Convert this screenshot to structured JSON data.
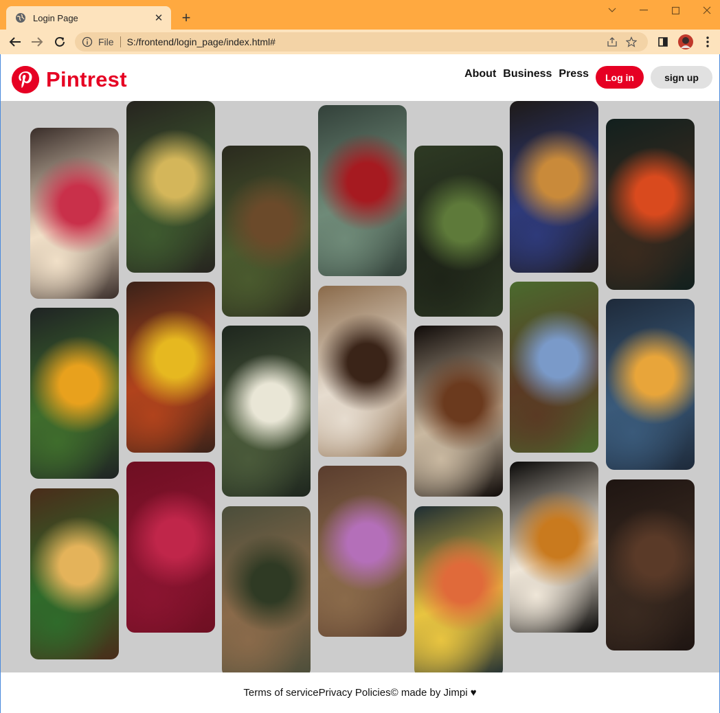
{
  "browser": {
    "tab_title": "Login Page",
    "tab_close": "✕",
    "new_tab": "+",
    "scheme": "File",
    "url": "S:/frontend/login_page/index.html#",
    "controls": {
      "chevron": "⌄",
      "minimize": "—",
      "maximize": "☐",
      "close": "✕"
    }
  },
  "header": {
    "brand": "Pintrest",
    "nav": [
      "About",
      "Business",
      "Press"
    ],
    "login_label": "Log in",
    "signup_label": "sign up",
    "brand_color": "#e60023"
  },
  "pins": [
    {
      "subject": "raspberry cake slice",
      "colors": [
        "#3a2e2a",
        "#c9304a",
        "#f1e0c8"
      ]
    },
    {
      "subject": "salad plate with orange juice",
      "colors": [
        "#1f2324",
        "#e8a11d",
        "#3f6d2c"
      ]
    },
    {
      "subject": "pizza on wooden board",
      "colors": [
        "#4a2c1a",
        "#e4b35a",
        "#2f6b2b"
      ]
    },
    {
      "subject": "toast with egg and cookies",
      "colors": [
        "#26241f",
        "#d4b65a",
        "#3e5a2f"
      ]
    },
    {
      "subject": "yellow door in foliage",
      "colors": [
        "#3a2219",
        "#e6b820",
        "#b1431c"
      ]
    },
    {
      "subject": "raspberries close-up",
      "colors": [
        "#6e0f22",
        "#c0264a",
        "#8a1430"
      ]
    },
    {
      "subject": "forest path",
      "colors": [
        "#2a2a1e",
        "#6b4a2a",
        "#4a5a2e"
      ]
    },
    {
      "subject": "chamomile flowers",
      "colors": [
        "#1e261e",
        "#e9e6d6",
        "#4a5a3a"
      ]
    },
    {
      "subject": "armchair with plant",
      "colors": [
        "#4a4d3a",
        "#2f3a24",
        "#8a6a4a"
      ]
    },
    {
      "subject": "bowl of cherries",
      "colors": [
        "#33413a",
        "#a61a20",
        "#6f8a78"
      ]
    },
    {
      "subject": "chocolate dessert glass",
      "colors": [
        "#8a6a4a",
        "#3a2418",
        "#e6dccf"
      ]
    },
    {
      "subject": "purple ice cream",
      "colors": [
        "#5a3d2e",
        "#b46fb9",
        "#8a6a4a"
      ]
    },
    {
      "subject": "forest stairs",
      "colors": [
        "#2e3a24",
        "#5e7a3a",
        "#1e2418"
      ]
    },
    {
      "subject": "coffee cup with beans",
      "colors": [
        "#0f0a08",
        "#6b3a1e",
        "#c9b8a0"
      ]
    },
    {
      "subject": "fruit platter",
      "colors": [
        "#1e2d33",
        "#e06a3a",
        "#e8c440"
      ]
    },
    {
      "subject": "french toast with berries",
      "colors": [
        "#1e1a18",
        "#c98a3a",
        "#2e3a7a"
      ]
    },
    {
      "subject": "hobbit house",
      "colors": [
        "#4a6a2e",
        "#7a9ac9",
        "#5a3a24"
      ]
    },
    {
      "subject": "caramel ice cream",
      "colors": [
        "#0a0908",
        "#c97a1e",
        "#efe6d8"
      ]
    },
    {
      "subject": "lantern street at night",
      "colors": [
        "#12201e",
        "#d94a1e",
        "#3a2a1e"
      ]
    },
    {
      "subject": "oatmeal bowl on blue",
      "colors": [
        "#1e2a3a",
        "#e8a53a",
        "#3a5a7a"
      ]
    },
    {
      "subject": "chocolate cake and cupcakes",
      "colors": [
        "#1e1512",
        "#5a3a28",
        "#3a2a20"
      ]
    }
  ],
  "footer": {
    "terms": "Terms of service",
    "privacy": "Privacy Policies",
    "credit": "© made by Jimpi ♥"
  }
}
